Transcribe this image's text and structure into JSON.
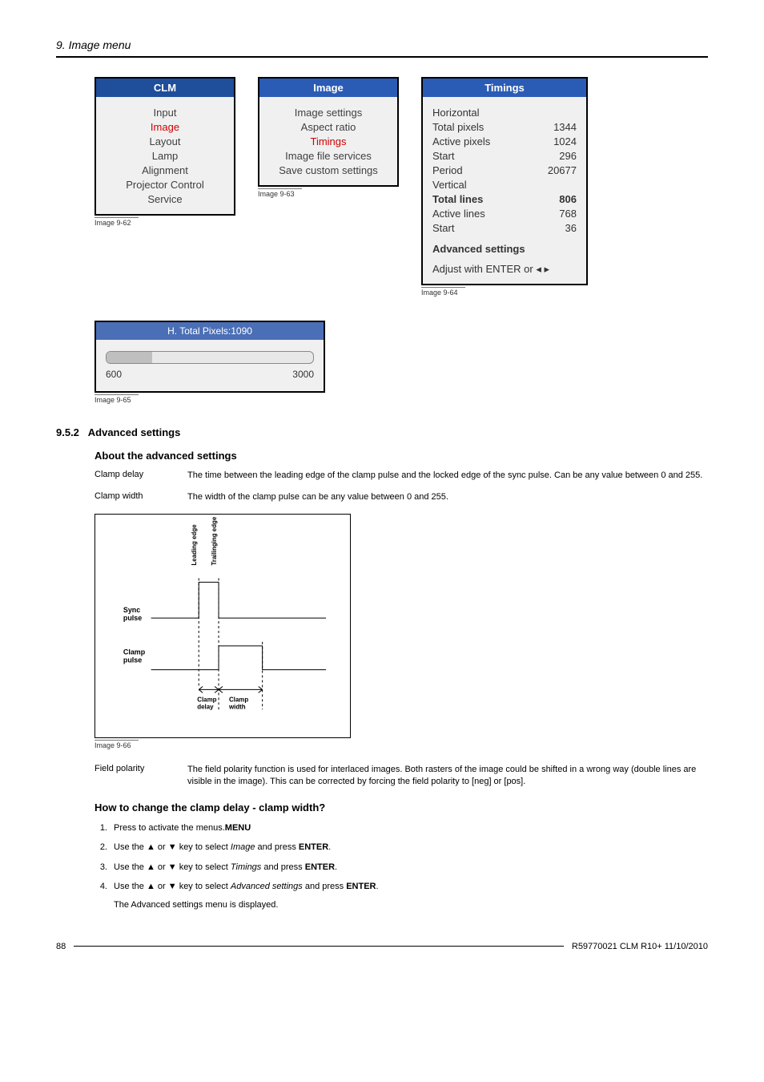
{
  "chapter_title": "9. Image menu",
  "menus": {
    "clm": {
      "title": "CLM",
      "items": [
        "Input",
        "Image",
        "Layout",
        "Lamp",
        "Alignment",
        "Projector Control",
        "Service"
      ],
      "active_index": 1,
      "caption": "Image 9-62"
    },
    "image": {
      "title": "Image",
      "items": [
        "Image settings",
        "Aspect ratio",
        "Timings",
        "Image file services",
        "Save custom settings"
      ],
      "active_index": 2,
      "caption": "Image 9-63"
    },
    "timings": {
      "title": "Timings",
      "horizontal": {
        "label": "Horizontal",
        "rows": [
          {
            "l": "Total pixels",
            "v": "1344"
          },
          {
            "l": "Active pixels",
            "v": "1024"
          },
          {
            "l": "Start",
            "v": "296"
          },
          {
            "l": "Period",
            "v": "20677"
          }
        ]
      },
      "vertical": {
        "label": "Vertical",
        "rows": [
          {
            "l": "Total lines",
            "v": "806",
            "b": true
          },
          {
            "l": "Active lines",
            "v": "768"
          },
          {
            "l": "Start",
            "v": "36"
          }
        ]
      },
      "advanced": "Advanced settings",
      "adjust": "Adjust with ENTER or ◂ ▸",
      "caption": "Image 9-64"
    }
  },
  "slider": {
    "title": "H. Total Pixels:1090",
    "min": "600",
    "max": "3000",
    "caption": "Image 9-65"
  },
  "section_number": "9.5.2",
  "section_title": "Advanced settings",
  "about_heading": "About the advanced settings",
  "defs": [
    {
      "term": "Clamp delay",
      "desc": "The time between the leading edge of the clamp pulse and the locked edge of the sync pulse. Can be any value between 0 and 255."
    },
    {
      "term": "Clamp width",
      "desc": "The width of the clamp pulse can be any value between 0 and 255."
    }
  ],
  "diagram": {
    "sync": "Sync pulse",
    "clamp": "Clamp pulse",
    "lead": "Leading edge",
    "trail": "Trailinging edge",
    "cdelay": "Clamp delay",
    "cwidth": "Clamp width",
    "caption": "Image 9-66"
  },
  "def_field": {
    "term": "Field polarity",
    "desc": "The field polarity function is used for interlaced images. Both rasters of the image could be shifted in a wrong way (double lines are visible in the image). This can be corrected by forcing the field polarity to [neg] or [pos]."
  },
  "howto_heading": "How to change the clamp delay - clamp width?",
  "steps": [
    {
      "p": "Press ",
      "b": "MENU",
      "r": " to activate the menus."
    },
    {
      "p": "Use the ▲ or ▼ key to select ",
      "i": "Image",
      "r": " and press ",
      "b": "ENTER",
      "suf": "."
    },
    {
      "p": "Use the ▲ or ▼ key to select ",
      "i": "Timings",
      "r": " and press ",
      "b": "ENTER",
      "suf": "."
    },
    {
      "p": "Use the ▲ or ▼ key to select ",
      "i": "Advanced settings",
      "r": " and press ",
      "b": "ENTER",
      "suf": "."
    }
  ],
  "step_response": "The Advanced settings menu is displayed.",
  "footer": {
    "page": "88",
    "doc": "R59770021 CLM R10+ 11/10/2010"
  }
}
